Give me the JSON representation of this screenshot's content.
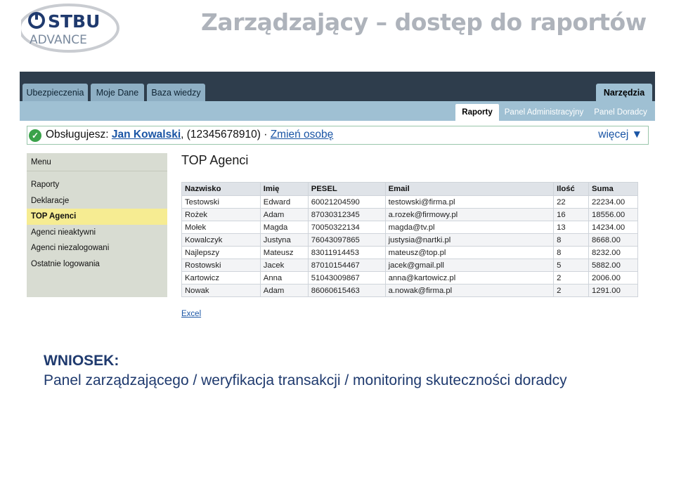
{
  "logo": {
    "line1": "STBU",
    "line2": "ADVANCE"
  },
  "slide_title": "Zarządzający – dostęp do raportów",
  "tabs": [
    {
      "label": "Ubezpieczenia"
    },
    {
      "label": "Moje Dane"
    },
    {
      "label": "Baza wiedzy"
    },
    {
      "label": "Narzędzia"
    }
  ],
  "subtabs": [
    {
      "label": "Raporty"
    },
    {
      "label": "Panel Administracyjny"
    },
    {
      "label": "Panel Doradcy"
    }
  ],
  "status": {
    "prefix": "Obsługujesz: ",
    "agent_name": "Jan Kowalski",
    "id_text": ", (12345678910) · ",
    "change_link": "Zmień osobę",
    "more_label": "więcej ▼"
  },
  "menu": {
    "header": "Menu",
    "items": [
      {
        "label": "Raporty"
      },
      {
        "label": "Deklaracje"
      },
      {
        "label": "TOP Agenci"
      },
      {
        "label": "Agenci nieaktywni"
      },
      {
        "label": "Agenci niezalogowani"
      },
      {
        "label": "Ostatnie logowania"
      }
    ]
  },
  "page_heading": "TOP Agenci",
  "table": {
    "columns": [
      "Nazwisko",
      "Imię",
      "PESEL",
      "Email",
      "Ilość",
      "Suma"
    ],
    "rows": [
      [
        "Testowski",
        "Edward",
        "60021204590",
        "testowski@firma.pl",
        "22",
        "22234.00"
      ],
      [
        "Rożek",
        "Adam",
        "87030312345",
        "a.rozek@firmowy.pl",
        "16",
        "18556.00"
      ],
      [
        "Mołek",
        "Magda",
        "70050322134",
        "magda@tv.pl",
        "13",
        "14234.00"
      ],
      [
        "Kowalczyk",
        "Justyna",
        "76043097865",
        "justysia@nartki.pl",
        "8",
        "8668.00"
      ],
      [
        "Najlepszy",
        "Mateusz",
        "83011914453",
        "mateusz@top.pl",
        "8",
        "8232.00"
      ],
      [
        "Rostowski",
        "Jacek",
        "87010154467",
        "jacek@gmail.pll",
        "5",
        "5882.00"
      ],
      [
        "Kartowicz",
        "Anna",
        "51043009867",
        "anna@kartowicz.pl",
        "2",
        "2006.00"
      ],
      [
        "Nowak",
        "Adam",
        "86060615463",
        "a.nowak@firma.pl",
        "2",
        "1291.00"
      ]
    ]
  },
  "excel_link": "Excel",
  "conclusion": {
    "label": "WNIOSEK:",
    "text": "Panel zarządzającego / weryfikacja transakcji / monitoring skuteczności doradcy"
  },
  "colors": {
    "topbar": "#2e3d4c",
    "tab": "#8eafc4",
    "subbar": "#9fc0d3",
    "menu_active": "#f6ec92",
    "link": "#1a55a5",
    "conclusion": "#1f3a6e",
    "title": "#aeb3bb"
  }
}
